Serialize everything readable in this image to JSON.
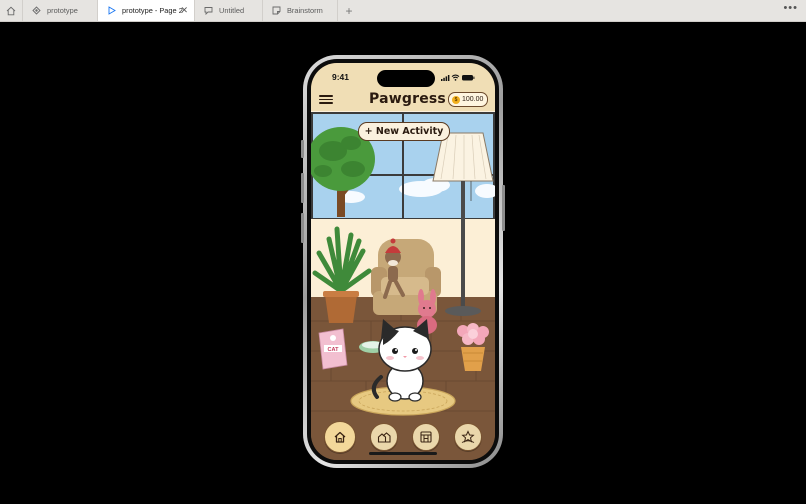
{
  "tabs": [
    {
      "label": "prototype",
      "icon": "prototype-file-icon",
      "active": false
    },
    {
      "label": "prototype - Page 2",
      "icon": "play-icon",
      "active": true
    },
    {
      "label": "Untitled",
      "icon": "chat-bubble-icon",
      "active": false
    },
    {
      "label": "Brainstorm",
      "icon": "sticky-note-icon",
      "active": false
    }
  ],
  "tab_close": "✕",
  "new_tab": "+",
  "more_menu": "•••",
  "phone": {
    "time": "9:41",
    "app_title": "Pawgress",
    "coins": "100.00",
    "coin_symbol": "$",
    "new_activity_label": "+ New Activity",
    "nav": [
      "home-icon",
      "friends-icon",
      "shop-icon",
      "achievements-icon"
    ]
  },
  "colors": {
    "accent": "#1976f2",
    "header_bg": "#f0deb5",
    "floor": "#7a563a"
  }
}
